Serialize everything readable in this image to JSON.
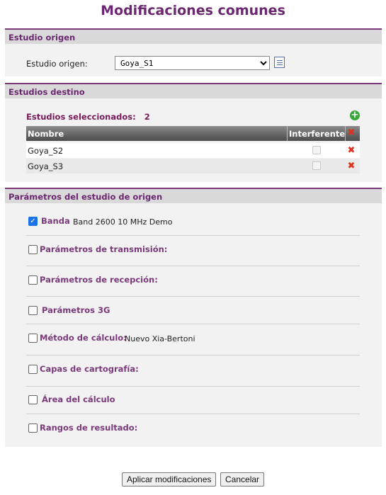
{
  "page_title": "Modificaciones comunes",
  "origin_section": {
    "header": "Estudio origen",
    "label": "Estudio origen:",
    "selected_value": "Goya_S1"
  },
  "dest_section": {
    "header": "Estudios destino",
    "selected_label": "Estudios seleccionados:",
    "selected_count": "2",
    "columns": [
      "Nombre",
      "Interferente"
    ],
    "rows": [
      {
        "name": "Goya_S2"
      },
      {
        "name": "Goya_S3"
      }
    ]
  },
  "params_section": {
    "header": "Parámetros del estudio de origen",
    "items": [
      {
        "label": "Banda",
        "value": "Band 2600 10 MHz Demo",
        "checked": true
      },
      {
        "label": "Parámetros de transmisión:",
        "value": "",
        "checked": false
      },
      {
        "label": "Parámetros de recepción:",
        "value": "",
        "checked": false
      },
      {
        "label": "Parámetros 3G",
        "value": "",
        "checked": false
      },
      {
        "label": "Método de cálculo:",
        "value": "Nuevo Xia-Bertoni",
        "checked": false
      },
      {
        "label": "Capas de cartografía:",
        "value": "",
        "checked": false
      },
      {
        "label": "Área del cálculo",
        "value": "",
        "checked": false
      },
      {
        "label": "Rangos de resultado:",
        "value": "",
        "checked": false
      }
    ]
  },
  "buttons": {
    "apply": "Aplicar modificaciones",
    "cancel": "Cancelar"
  }
}
